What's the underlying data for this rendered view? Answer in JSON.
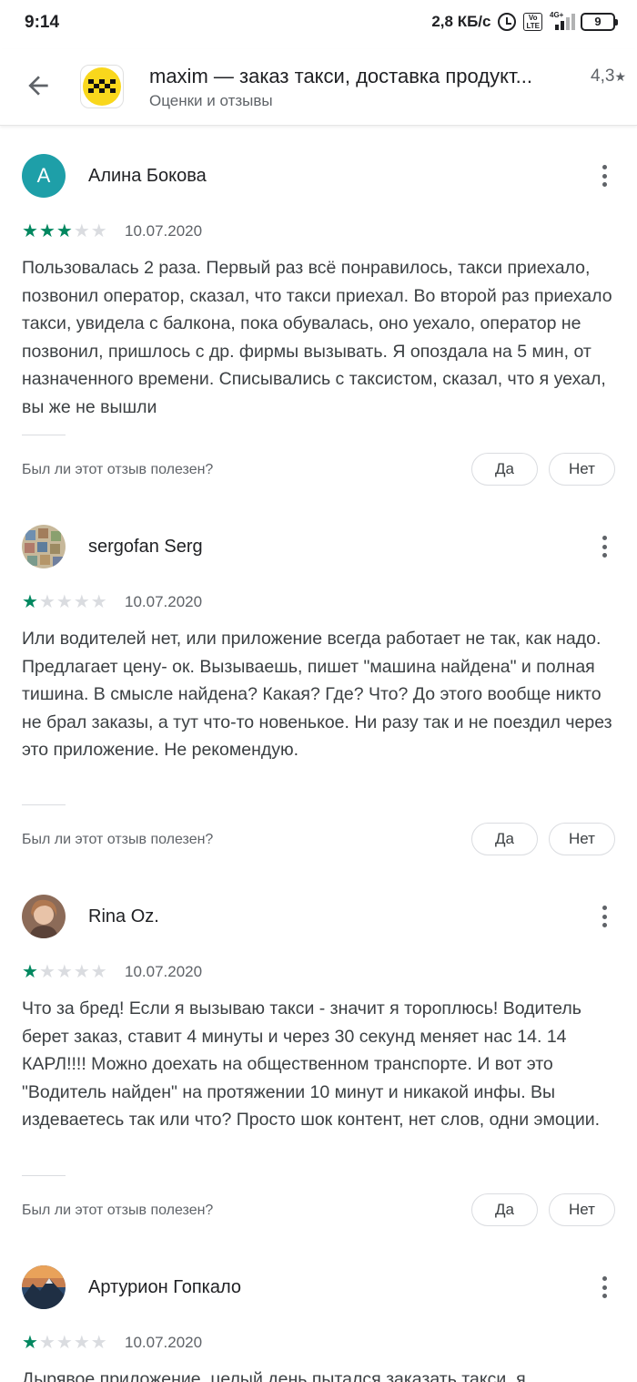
{
  "status_bar": {
    "time": "9:14",
    "net_speed": "2,8 КБ/с",
    "network_type": "4G+",
    "volte": "Vo LTE",
    "battery": "9"
  },
  "header": {
    "app_title": "maxim — заказ такси, доставка продукт...",
    "subtitle": "Оценки и отзывы",
    "rating": "4,3"
  },
  "reviews": [
    {
      "author": "Алина Бокова",
      "avatar_letter": "A",
      "stars": 3,
      "date": "10.07.2020",
      "text": "Пользовалась 2 раза. Первый раз всё понравилось, такси приехало, позвонил оператор, сказал, что такси приехал. Во второй раз приехало такси, увидела с балкона, пока обувалась, оно уехало, оператор не позвонил, пришлось с др. фирмы вызывать. Я опоздала на 5 мин, от назначенного времени. Списывались с таксистом, сказал, что я уехал, вы же не вышли",
      "helpful_question": "Был ли этот отзыв полезен?",
      "yes": "Да",
      "no": "Нет"
    },
    {
      "author": "sergofan Serg",
      "avatar_letter": "",
      "stars": 1,
      "date": "10.07.2020",
      "text": "Или водителей нет, или приложение всегда работает не так, как надо. Предлагает цену- ок. Вызываешь, пишет \"машина найдена\" и полная тишина. В смысле найдена? Какая? Где? Что? До этого вообще никто не брал заказы, а тут что-то новенькое. Ни разу так и не поездил через это приложение. Не рекомендую.",
      "helpful_question": "Был ли этот отзыв полезен?",
      "yes": "Да",
      "no": "Нет"
    },
    {
      "author": "Rina Oz.",
      "avatar_letter": "",
      "stars": 1,
      "date": "10.07.2020",
      "text": "Что за бред! Если я вызываю такси - значит я тороплюсь! Водитель берет заказ, ставит 4 минуты и через 30 секунд меняет нас 14. 14 КАРЛ!!!! Можно доехать на общественном транспорте. И вот это \"Водитель найден\" на протяжении 10 минут и никакой инфы. Вы издеваетесь так или что? Просто шок контент, нет слов, одни эмоции.",
      "helpful_question": "Был ли этот отзыв полезен?",
      "yes": "Да",
      "no": "Нет"
    },
    {
      "author": "Артурион Гопкало",
      "avatar_letter": "",
      "stars": 1,
      "date": "10.07.2020",
      "text": "Дырявое приложение, целый день пытался заказать такси, я"
    }
  ],
  "colors": {
    "star_on": "#01875f",
    "star_off": "#dadce0",
    "avatar_a": "#1e9fa8",
    "app_icon": "#f9d71c"
  }
}
